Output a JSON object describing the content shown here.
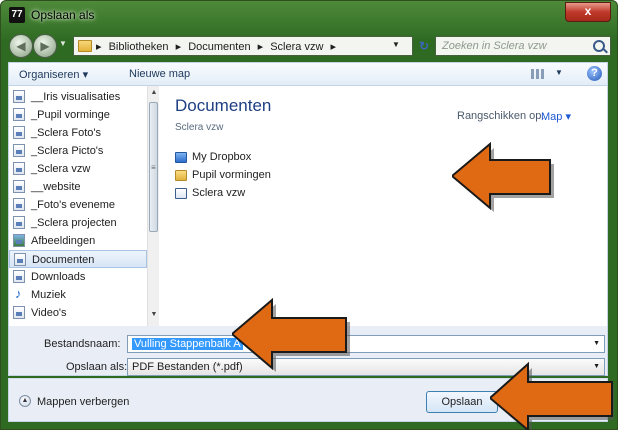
{
  "window": {
    "title": "Opslaan als",
    "close_label": "x"
  },
  "nav": {
    "breadcrumbs": [
      "Bibliotheken",
      "Documenten",
      "Sclera vzw"
    ],
    "search_placeholder": "Zoeken in Sclera vzw"
  },
  "toolbar": {
    "organize_label": "Organiseren ▾",
    "new_folder_label": "Nieuwe map"
  },
  "sidebar": {
    "items": [
      {
        "label": "__Iris visualisaties",
        "icon": "library-doc-icon"
      },
      {
        "label": "_Pupil vorminge",
        "icon": "library-doc-icon"
      },
      {
        "label": "_Sclera Foto's",
        "icon": "library-doc-icon"
      },
      {
        "label": "_Sclera Picto's",
        "icon": "library-doc-icon"
      },
      {
        "label": "_Sclera vzw",
        "icon": "library-doc-icon"
      },
      {
        "label": "__website",
        "icon": "library-doc-icon"
      },
      {
        "label": "_Foto's eveneme",
        "icon": "library-doc-icon"
      },
      {
        "label": "_Sclera projecten",
        "icon": "library-doc-icon"
      },
      {
        "label": "Afbeeldingen",
        "icon": "pictures-icon"
      },
      {
        "label": "Documenten",
        "icon": "documents-icon",
        "selected": true
      },
      {
        "label": "Downloads",
        "icon": "library-doc-icon"
      },
      {
        "label": "Muziek",
        "icon": "music-icon"
      },
      {
        "label": "Video's",
        "icon": "library-doc-icon"
      }
    ]
  },
  "main": {
    "library_title": "Documenten",
    "library_subtitle": "Sclera vzw",
    "arrange_label": "Rangschikken op:",
    "arrange_value": "Map ▾",
    "files": [
      {
        "label": "My Dropbox",
        "icon": "dropbox-folder-icon"
      },
      {
        "label": "Pupil vormingen",
        "icon": "folder-icon"
      },
      {
        "label": "Sclera vzw",
        "icon": "document-icon"
      }
    ]
  },
  "form": {
    "filename_label": "Bestandsnaam:",
    "filename_value": "Vulling Stappenbalk A",
    "type_label": "Opslaan als:",
    "type_value": "PDF Bestanden (*.pdf)"
  },
  "footer": {
    "hide_folders_label": "Mappen verbergen",
    "save_label": "Opslaan",
    "cancel_label": ""
  },
  "colors": {
    "frame": "#2e6a22",
    "accent": "#1e3f83",
    "arrow": "#e06a14",
    "selection": "#3399ff"
  }
}
